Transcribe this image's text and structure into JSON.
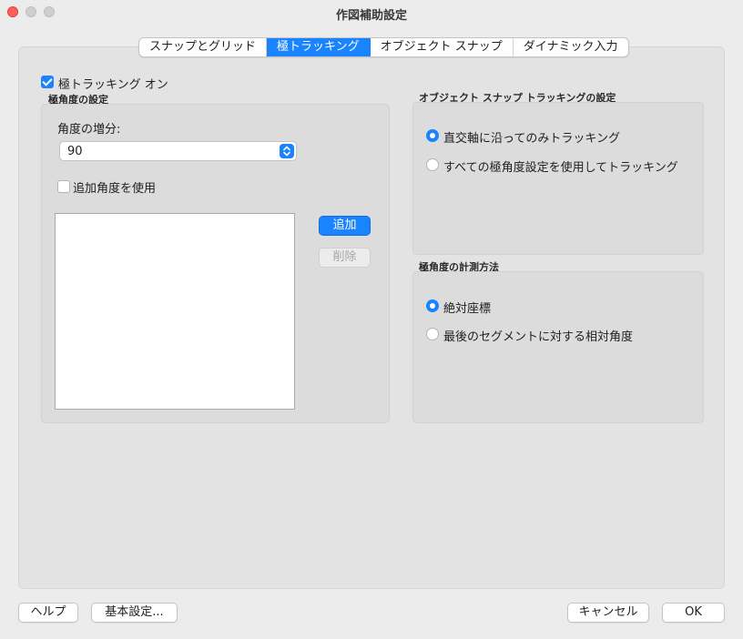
{
  "window": {
    "title": "作図補助設定"
  },
  "tabs": [
    {
      "label": "スナップとグリッド",
      "active": false
    },
    {
      "label": "極トラッキング",
      "active": true
    },
    {
      "label": "オブジェクト スナップ",
      "active": false
    },
    {
      "label": "ダイナミック入力",
      "active": false
    }
  ],
  "polar_on": {
    "label": "極トラッキング オン",
    "checked": true
  },
  "polar_angle": {
    "group_title": "極角度の設定",
    "increment_label": "角度の増分:",
    "increment_value": "90",
    "additional_label": "追加角度を使用",
    "additional_checked": false,
    "add_button": "追加",
    "delete_button": "削除"
  },
  "osnap_tracking": {
    "group_title": "オブジェクト スナップ トラッキングの設定",
    "option1": "直交軸に沿ってのみトラッキング",
    "option2": "すべての極角度設定を使用してトラッキング",
    "selected": 1
  },
  "measurement": {
    "group_title": "極角度の計測方法",
    "option1": "絶対座標",
    "option2": "最後のセグメントに対する相対角度",
    "selected": 1
  },
  "footer": {
    "help": "ヘルプ",
    "preferences": "基本設定...",
    "cancel": "キャンセル",
    "ok": "OK"
  },
  "colors": {
    "accent": "#1a84ff",
    "close": "#fe5f57"
  }
}
